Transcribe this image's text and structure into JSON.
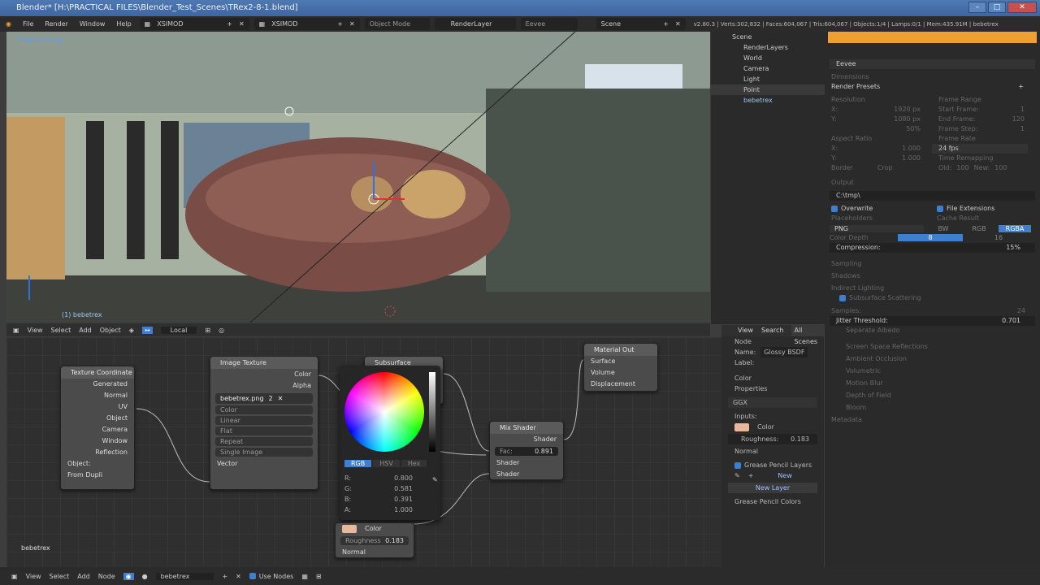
{
  "window": {
    "title": "Blender* [H:\\PRACTICAL FILES\\Blender_Test_Scenes\\TRex2-8-1.blend]"
  },
  "topbar": {
    "menus": [
      "File",
      "Render",
      "Window",
      "Help"
    ],
    "workspace1": "XSIMOD",
    "workspace2": "XSIMOD",
    "mode": "Object Mode",
    "render_layer": "RenderLayer",
    "engine": "Eevee",
    "scene": "Scene",
    "stats": "v2.80.3 | Verts:302,832 | Faces:604,067 | Tris:604,067 | Objects:1/4 | Lamps:0/1 | Mem:435.91M | bebetrex"
  },
  "viewport": {
    "label_top": "Camera Persp",
    "label_bottom": "(1) bebetrex",
    "menus": [
      "View",
      "Select",
      "Add",
      "Object"
    ],
    "orientation": "Local"
  },
  "outliner": {
    "items": [
      "Scene",
      "RenderLayers",
      "World",
      "Camera",
      "Light",
      "Point",
      "bebetrex"
    ]
  },
  "props": {
    "engine": "Eevee",
    "dimensions": "Dimensions",
    "render_presets": "Render Presets",
    "resolution": "Resolution",
    "res_x_label": "X:",
    "res_x": "1920 px",
    "res_y_label": "Y:",
    "res_y": "1080 px",
    "res_pct": "50%",
    "frame_range": "Frame Range",
    "start_frame": "Start Frame:",
    "start_val": "1",
    "end_frame": "End Frame:",
    "end_val": "120",
    "frame_step": "Frame Step:",
    "step_val": "1",
    "aspect_ratio": "Aspect Ratio",
    "asp_x_label": "X:",
    "asp_x": "1.000",
    "asp_y_label": "Y:",
    "asp_y": "1.000",
    "frame_rate": "Frame Rate",
    "fps": "24 fps",
    "time_remapping": "Time Remapping",
    "old_label": "Old:",
    "old_val": "100",
    "new_label": "New:",
    "new_val": "100",
    "border": "Border",
    "crop": "Crop",
    "output": "Output",
    "path": "C:\\tmp\\",
    "overwrite": "Overwrite",
    "file_extensions": "File Extensions",
    "placeholders": "Placeholders",
    "cache_result": "Cache Result",
    "format": "PNG",
    "bw": "BW",
    "rgb": "RGB",
    "rgba": "RGBA",
    "color_depth": "Color Depth",
    "depth8": "8",
    "depth16": "16",
    "compression": "Compression:",
    "comp_val": "15%",
    "sampling": "Sampling",
    "shadows": "Shadows",
    "indirect": "Indirect Lighting",
    "sss": "Subsurface Scattering",
    "samples": "Samples:",
    "samples_val": "24",
    "jitter": "Jitter Threshold:",
    "jitter_val": "0.701",
    "separate_albedo": "Separate Albedo",
    "ssr": "Screen Space Reflections",
    "ao": "Ambient Occlusion",
    "volumetric": "Volumetric",
    "motion_blur": "Motion Blur",
    "dof": "Depth of Field",
    "bloom": "Bloom",
    "metadata": "Metadata"
  },
  "lowprops": {
    "menus": [
      "View",
      "Search",
      "All Scenes"
    ],
    "node": "Node",
    "name_label": "Name:",
    "name_val": "Glossy BSDF",
    "label_label": "Label:",
    "color": "Color",
    "properties": "Properties",
    "ggx": "GGX",
    "inputs": "Inputs:",
    "in_color": "Color",
    "roughness": "Roughness:",
    "roughness_val": "0.183",
    "normal": "Normal",
    "grease": "Grease Pencil Layers",
    "new": "New",
    "new_layer": "New Layer",
    "grease_colors": "Grease Pencil Colors"
  },
  "nodes": {
    "texcoord": {
      "title": "Texture Coordinate",
      "outs": [
        "Generated",
        "Normal",
        "UV",
        "Object",
        "Camera",
        "Window",
        "Reflection"
      ],
      "object": "Object:",
      "from_instancer": "From Dupli"
    },
    "imgtex": {
      "title": "Image Texture",
      "outs": [
        "Color",
        "Alpha"
      ],
      "image": "bebetrex.png",
      "users": "2",
      "opts": [
        "Color",
        "Linear",
        "Flat",
        "Repeat",
        "Single Image"
      ],
      "vector": "Vector"
    },
    "sss": {
      "title": "Subsurface Scattering"
    },
    "mix": {
      "title": "Mix Shader",
      "out": "Shader",
      "fac": "Fac:",
      "fac_val": "0.891",
      "in1": "Shader",
      "in2": "Shader"
    },
    "matout": {
      "title": "Material Out",
      "ins": [
        "Surface",
        "Volume",
        "Displacement"
      ]
    },
    "glossy": {
      "color": "Color",
      "roughness": "Roughness",
      "roughness_val": "0.183",
      "normal": "Normal"
    },
    "picker": {
      "tabs": [
        "RGB",
        "HSV",
        "Hex"
      ],
      "labels": [
        "R:",
        "G:",
        "B:",
        "A:"
      ],
      "vals": [
        "0.800",
        "0.581",
        "0.391",
        "1.000"
      ]
    }
  },
  "nodeeditor": {
    "object_label": "bebetrex"
  },
  "bottom": {
    "menus": [
      "View",
      "Select",
      "Add",
      "Node"
    ],
    "material": "bebetrex",
    "use_nodes": "Use Nodes"
  },
  "colors": {
    "accent": "#3f7fcf",
    "title_blue": "#4f79b3",
    "orange": "#f0a030"
  }
}
